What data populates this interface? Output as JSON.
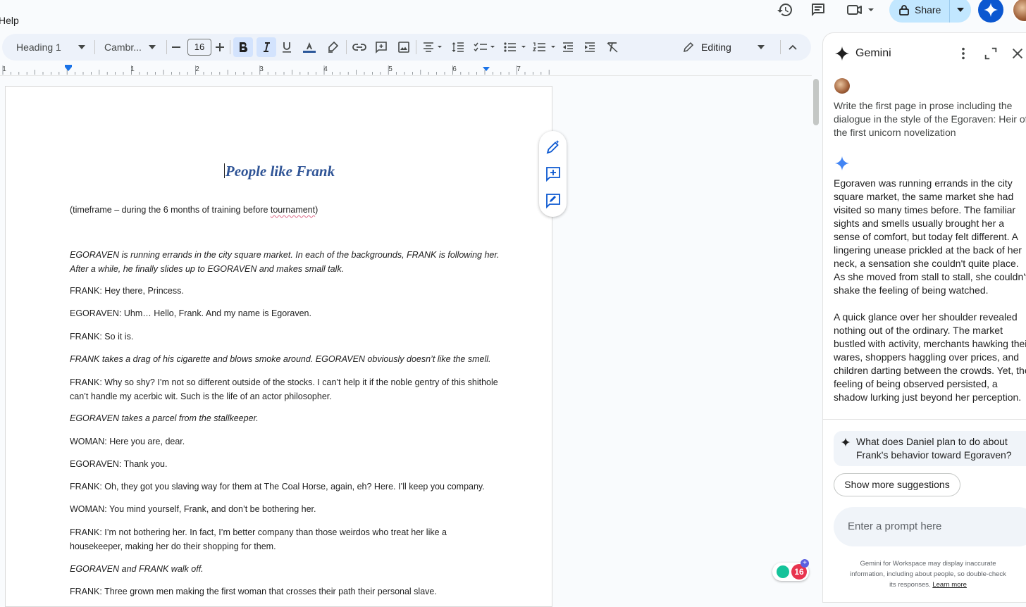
{
  "menu": {
    "help": "Help"
  },
  "topbar": {
    "share_label": "Share"
  },
  "toolbar": {
    "style": "Heading 1",
    "font": "Cambr...",
    "font_size": "16",
    "mode": "Editing"
  },
  "ruler": {
    "marks": [
      "1",
      "1",
      "2",
      "3",
      "4",
      "5",
      "6",
      "7"
    ]
  },
  "doc": {
    "title": "People like Frank",
    "timeframe_before": "(timeframe – during the 6 months of training before ",
    "timeframe_word": "tournament",
    "timeframe_after": ")",
    "lines": [
      {
        "text": "EGORAVEN is running errands in the city square market. In each of the backgrounds, FRANK is following her. After a while, he finally slides up to EGORAVEN and makes small talk.",
        "italic": true
      },
      {
        "text": "FRANK: Hey there, Princess.",
        "italic": false
      },
      {
        "text": "EGORAVEN: Uhm… Hello, Frank. And my name is Egoraven.",
        "italic": false
      },
      {
        "text": "FRANK: So it is.",
        "italic": false
      },
      {
        "text": "FRANK takes a drag of his cigarette and blows smoke around. EGORAVEN obviously doesn’t like the smell.",
        "italic": true
      },
      {
        "text": "FRANK: Why so shy? I’m not so different outside of the stocks. I can’t help it if the noble gentry of this shithole can’t handle my acerbic wit. Such is the life of an actor philosopher.",
        "italic": false
      },
      {
        "text": "EGORAVEN takes a parcel from the stallkeeper.",
        "italic": true
      },
      {
        "text": "WOMAN: Here you are, dear.",
        "italic": false
      },
      {
        "text": "EGORAVEN: Thank you.",
        "italic": false
      },
      {
        "text": "FRANK: Oh, they got you slaving way for them at The Coal Horse, again, eh? Here. I’ll keep you company.",
        "italic": false
      },
      {
        "text": "WOMAN: You mind yourself, Frank, and don’t be bothering her.",
        "italic": false
      },
      {
        "text": "FRANK: I’m not bothering her. In fact, I’m better company than those weirdos who treat her like a housekeeper, making her do their shopping for them.",
        "italic": false
      },
      {
        "text": "EGORAVEN and FRANK walk off.",
        "italic": true
      },
      {
        "text": "FRANK: Three grown men making the first woman that crosses their path their personal slave.",
        "italic": false
      }
    ]
  },
  "gemini": {
    "title": "Gemini",
    "user_prompt": "Write the first page in prose including the dialogue in the style of the Egoraven: Heir of the first unicorn novelization",
    "response": [
      "Egoraven was running errands in the city square market, the same market she had visited so many times before. The familiar sights and smells usually brought her a sense of comfort, but today felt different. A lingering unease prickled at the back of her neck, a sensation she couldn't quite place. As she moved from stall to stall, she couldn't shake the feeling of being watched.",
      "A quick glance over her shoulder revealed nothing out of the ordinary. The market bustled with activity, merchants hawking their wares, shoppers haggling over prices, and children darting between the crowds. Yet, the feeling of being observed persisted, a shadow lurking just beyond her perception."
    ],
    "suggestion": "What does Daniel plan to do about Frank's behavior toward Egoraven?",
    "more_label": "Show more suggestions",
    "prompt_placeholder": "Enter a prompt here",
    "disclaimer": "Gemini for Workspace may display inaccurate information, including about people, so double-check its responses.",
    "disclaimer_link": "Learn more"
  },
  "grammarly": {
    "count": "16"
  }
}
